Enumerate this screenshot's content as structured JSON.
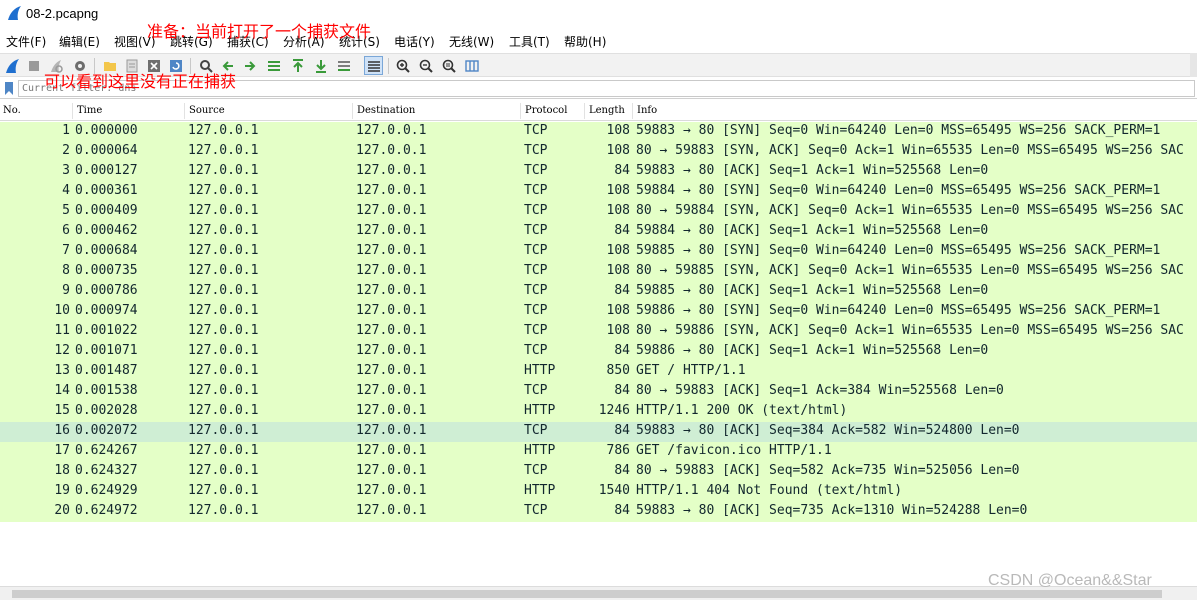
{
  "window": {
    "title": "08-2.pcapng"
  },
  "menu": [
    "文件(F)",
    "编辑(E)",
    "视图(V)",
    "跳转(G)",
    "捕获(C)",
    "分析(A)",
    "统计(S)",
    "电话(Y)",
    "无线(W)",
    "工具(T)",
    "帮助(H)"
  ],
  "filter": {
    "value": "Current filter: dns"
  },
  "columns": {
    "no": "No.",
    "time": "Time",
    "source": "Source",
    "destination": "Destination",
    "protocol": "Protocol",
    "length": "Length",
    "info": "Info"
  },
  "packets": [
    {
      "no": "1",
      "time": "0.000000",
      "src": "127.0.0.1",
      "dst": "127.0.0.1",
      "proto": "TCP",
      "len": "108",
      "info": "59883 → 80 [SYN] Seq=0 Win=64240 Len=0 MSS=65495 WS=256 SACK_PERM=1"
    },
    {
      "no": "2",
      "time": "0.000064",
      "src": "127.0.0.1",
      "dst": "127.0.0.1",
      "proto": "TCP",
      "len": "108",
      "info": "80 → 59883 [SYN, ACK] Seq=0 Ack=1 Win=65535 Len=0 MSS=65495 WS=256 SAC"
    },
    {
      "no": "3",
      "time": "0.000127",
      "src": "127.0.0.1",
      "dst": "127.0.0.1",
      "proto": "TCP",
      "len": "84",
      "info": "59883 → 80 [ACK] Seq=1 Ack=1 Win=525568 Len=0"
    },
    {
      "no": "4",
      "time": "0.000361",
      "src": "127.0.0.1",
      "dst": "127.0.0.1",
      "proto": "TCP",
      "len": "108",
      "info": "59884 → 80 [SYN] Seq=0 Win=64240 Len=0 MSS=65495 WS=256 SACK_PERM=1"
    },
    {
      "no": "5",
      "time": "0.000409",
      "src": "127.0.0.1",
      "dst": "127.0.0.1",
      "proto": "TCP",
      "len": "108",
      "info": "80 → 59884 [SYN, ACK] Seq=0 Ack=1 Win=65535 Len=0 MSS=65495 WS=256 SAC"
    },
    {
      "no": "6",
      "time": "0.000462",
      "src": "127.0.0.1",
      "dst": "127.0.0.1",
      "proto": "TCP",
      "len": "84",
      "info": "59884 → 80 [ACK] Seq=1 Ack=1 Win=525568 Len=0"
    },
    {
      "no": "7",
      "time": "0.000684",
      "src": "127.0.0.1",
      "dst": "127.0.0.1",
      "proto": "TCP",
      "len": "108",
      "info": "59885 → 80 [SYN] Seq=0 Win=64240 Len=0 MSS=65495 WS=256 SACK_PERM=1"
    },
    {
      "no": "8",
      "time": "0.000735",
      "src": "127.0.0.1",
      "dst": "127.0.0.1",
      "proto": "TCP",
      "len": "108",
      "info": "80 → 59885 [SYN, ACK] Seq=0 Ack=1 Win=65535 Len=0 MSS=65495 WS=256 SAC"
    },
    {
      "no": "9",
      "time": "0.000786",
      "src": "127.0.0.1",
      "dst": "127.0.0.1",
      "proto": "TCP",
      "len": "84",
      "info": "59885 → 80 [ACK] Seq=1 Ack=1 Win=525568 Len=0"
    },
    {
      "no": "10",
      "time": "0.000974",
      "src": "127.0.0.1",
      "dst": "127.0.0.1",
      "proto": "TCP",
      "len": "108",
      "info": "59886 → 80 [SYN] Seq=0 Win=64240 Len=0 MSS=65495 WS=256 SACK_PERM=1"
    },
    {
      "no": "11",
      "time": "0.001022",
      "src": "127.0.0.1",
      "dst": "127.0.0.1",
      "proto": "TCP",
      "len": "108",
      "info": "80 → 59886 [SYN, ACK] Seq=0 Ack=1 Win=65535 Len=0 MSS=65495 WS=256 SAC"
    },
    {
      "no": "12",
      "time": "0.001071",
      "src": "127.0.0.1",
      "dst": "127.0.0.1",
      "proto": "TCP",
      "len": "84",
      "info": "59886 → 80 [ACK] Seq=1 Ack=1 Win=525568 Len=0"
    },
    {
      "no": "13",
      "time": "0.001487",
      "src": "127.0.0.1",
      "dst": "127.0.0.1",
      "proto": "HTTP",
      "len": "850",
      "info": "GET / HTTP/1.1"
    },
    {
      "no": "14",
      "time": "0.001538",
      "src": "127.0.0.1",
      "dst": "127.0.0.1",
      "proto": "TCP",
      "len": "84",
      "info": "80 → 59883 [ACK] Seq=1 Ack=384 Win=525568 Len=0"
    },
    {
      "no": "15",
      "time": "0.002028",
      "src": "127.0.0.1",
      "dst": "127.0.0.1",
      "proto": "HTTP",
      "len": "1246",
      "info": "HTTP/1.1 200 OK  (text/html)"
    },
    {
      "no": "16",
      "time": "0.002072",
      "src": "127.0.0.1",
      "dst": "127.0.0.1",
      "proto": "TCP",
      "len": "84",
      "info": "59883 → 80 [ACK] Seq=384 Ack=582 Win=524800 Len=0"
    },
    {
      "no": "17",
      "time": "0.624267",
      "src": "127.0.0.1",
      "dst": "127.0.0.1",
      "proto": "HTTP",
      "len": "786",
      "info": "GET /favicon.ico HTTP/1.1"
    },
    {
      "no": "18",
      "time": "0.624327",
      "src": "127.0.0.1",
      "dst": "127.0.0.1",
      "proto": "TCP",
      "len": "84",
      "info": "80 → 59883 [ACK] Seq=582 Ack=735 Win=525056 Len=0"
    },
    {
      "no": "19",
      "time": "0.624929",
      "src": "127.0.0.1",
      "dst": "127.0.0.1",
      "proto": "HTTP",
      "len": "1540",
      "info": "HTTP/1.1 404 Not Found  (text/html)"
    },
    {
      "no": "20",
      "time": "0.624972",
      "src": "127.0.0.1",
      "dst": "127.0.0.1",
      "proto": "TCP",
      "len": "84",
      "info": "59883 → 80 [ACK] Seq=735 Ack=1310 Win=524288 Len=0"
    }
  ],
  "annotations": {
    "top": "准备：当前打开了一个捕获文件",
    "second": "可以看到这里没有正在捕获"
  },
  "watermark": "CSDN @Ocean&&Star",
  "colors": {
    "tcp_row": "#e4ffc7",
    "highlight_row": "#cfeed4",
    "annotation": "#ff0000"
  }
}
